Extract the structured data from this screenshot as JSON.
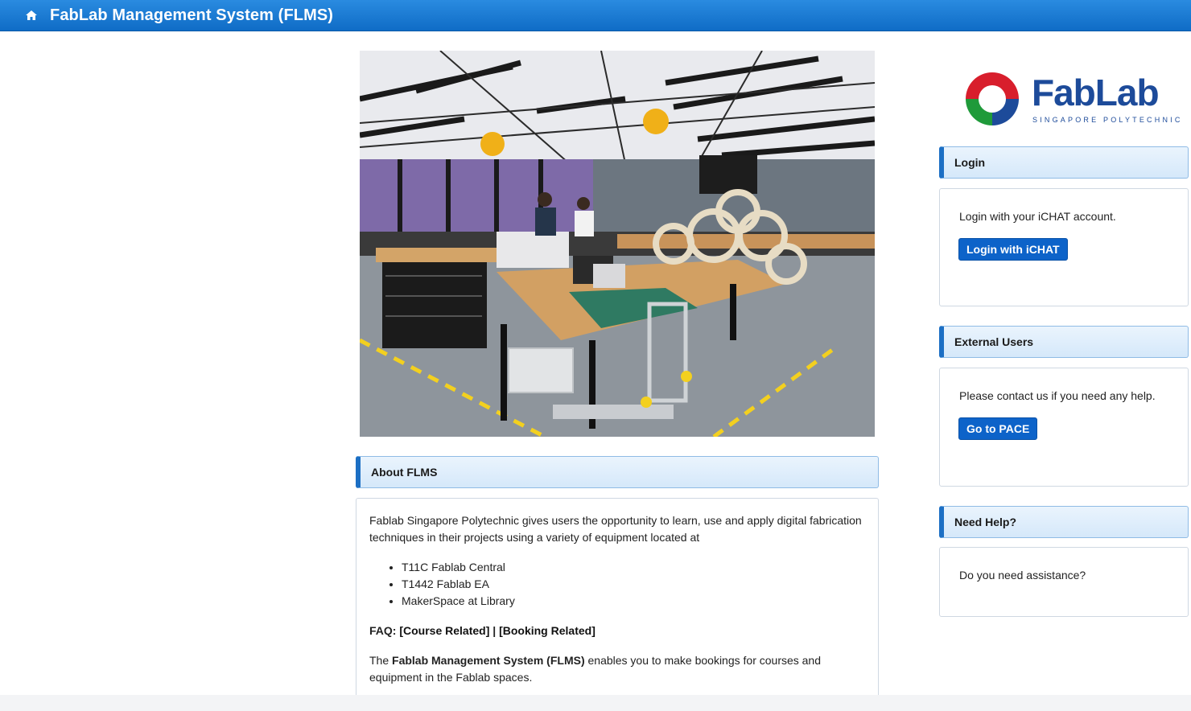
{
  "header": {
    "title": "FabLab Management System (FLMS)"
  },
  "logo": {
    "name": "FabLab",
    "subtitle": "SINGAPORE POLYTECHNIC"
  },
  "about": {
    "heading": "About FLMS",
    "intro": "Fablab Singapore Polytechnic gives users the opportunity to learn, use and apply digital fabrication techniques in their projects using a variety of equipment located at",
    "locations": [
      "T11C Fablab Central",
      "T1442 Fablab EA",
      "MakerSpace at Library"
    ],
    "faq_label": "FAQ:",
    "faq_course": "[Course Related]",
    "faq_sep": "|",
    "faq_booking": "[Booking Related]",
    "flms_pre": "The",
    "flms_name": "Fablab Management System (FLMS)",
    "flms_post": "enables you to make bookings for courses and equipment in the Fablab spaces."
  },
  "login": {
    "heading": "Login",
    "text": "Login with your iCHAT account.",
    "button": "Login with iCHAT"
  },
  "external": {
    "heading": "External Users",
    "text": "Please contact us if you need any help.",
    "button": "Go to PACE"
  },
  "help": {
    "heading": "Need Help?",
    "text": "Do you need assistance?"
  },
  "colors": {
    "header_blue": "#1676d3",
    "button_blue": "#0d63c9",
    "panel_accent": "#1c6fc4"
  }
}
